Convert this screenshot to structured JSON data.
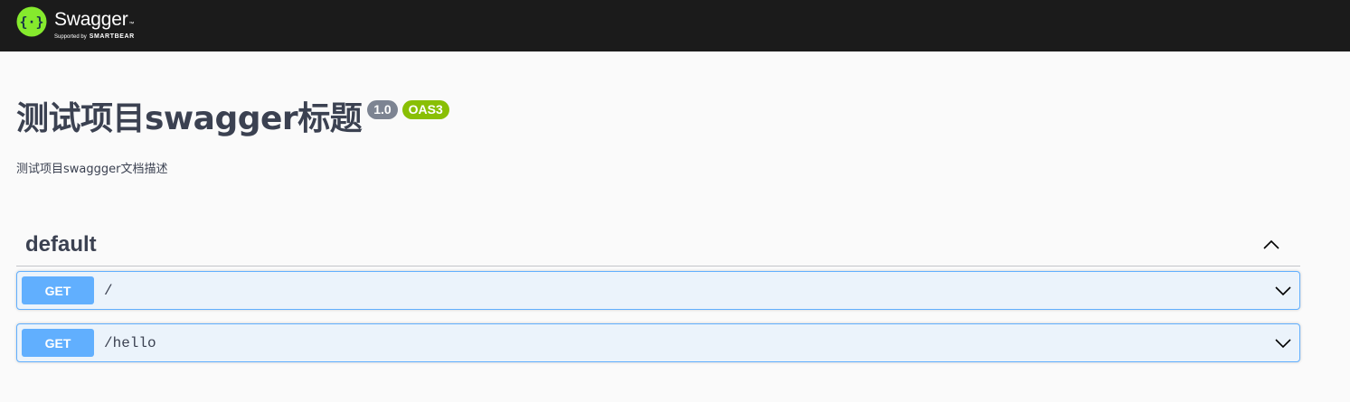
{
  "topbar": {
    "brand_name": "Swagger",
    "brand_tm": "™",
    "supported_by": "Supported by",
    "smartbear": "SMARTBEAR",
    "logo_icon": "swagger-logo-icon",
    "background_color": "#1b1b1b",
    "logo_color": "#85ea2d"
  },
  "info": {
    "title": "测试项目swagger标题",
    "version": "1.0",
    "oas_badge": "OAS3",
    "description": "测试项目swaggger文档描述"
  },
  "tag": {
    "name": "default",
    "expanded": true,
    "toggle_icon": "chevron-up-icon"
  },
  "operations": [
    {
      "method": "GET",
      "path": "/",
      "expand_icon": "chevron-down-icon"
    },
    {
      "method": "GET",
      "path": "/hello",
      "expand_icon": "chevron-down-icon"
    }
  ],
  "colors": {
    "get_method": "#61affe",
    "get_block_bg": "#ebf3fb",
    "version_badge": "#7d8492",
    "oas_badge": "#89bf04",
    "text": "#3b4151"
  }
}
